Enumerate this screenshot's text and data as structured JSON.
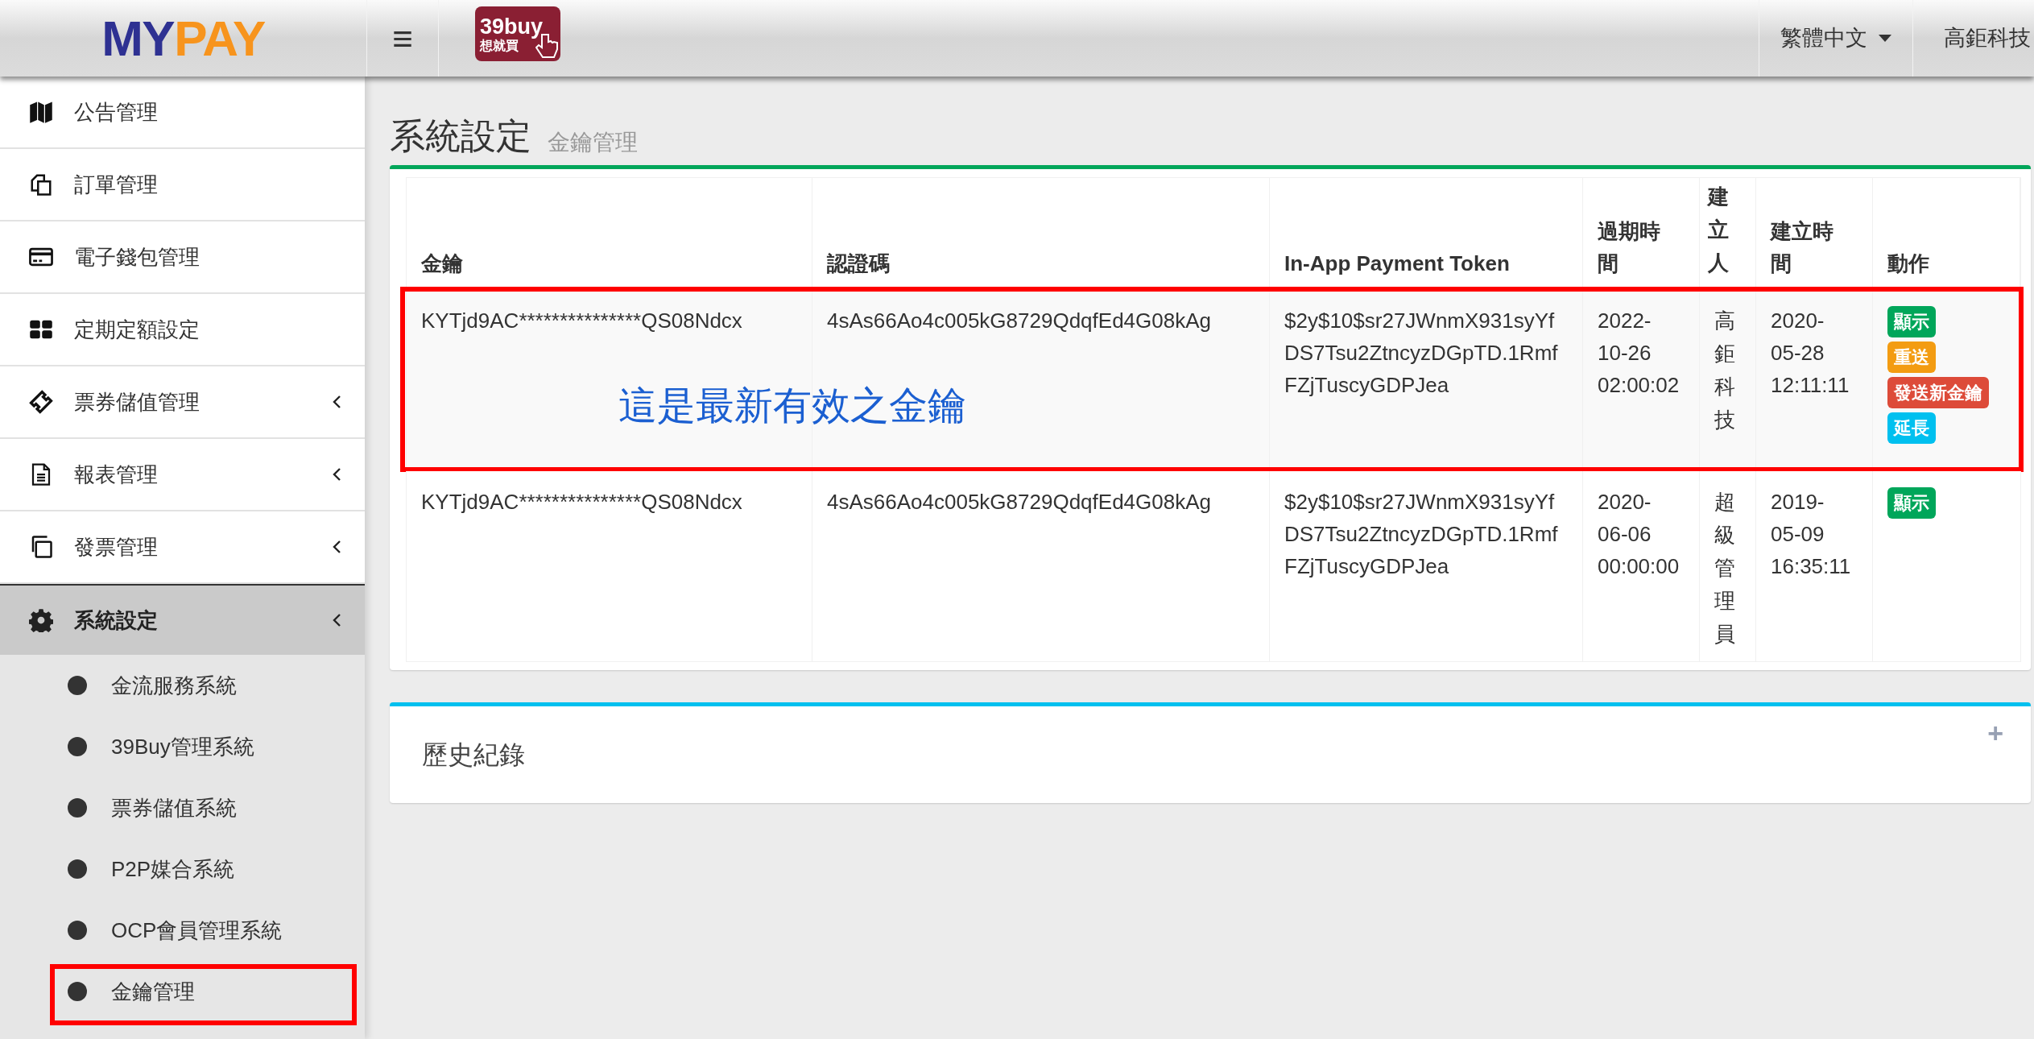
{
  "header": {
    "logo": [
      "MY",
      "PAY"
    ],
    "brand_logo": [
      "39buy",
      "想就買"
    ],
    "menu_glyph": "≡",
    "language": "繁體中文",
    "user": "高鉅科技"
  },
  "sidebar": {
    "items": [
      {
        "label": "公告管理",
        "has_submenu": false,
        "expanded": false
      },
      {
        "label": "訂單管理",
        "has_submenu": false,
        "expanded": false
      },
      {
        "label": "電子錢包管理",
        "has_submenu": false,
        "expanded": false
      },
      {
        "label": "定期定額設定",
        "has_submenu": false,
        "expanded": false
      },
      {
        "label": "票券儲值管理",
        "has_submenu": true,
        "expanded": false
      },
      {
        "label": "報表管理",
        "has_submenu": true,
        "expanded": false
      },
      {
        "label": "發票管理",
        "has_submenu": true,
        "expanded": false
      },
      {
        "label": "系統設定",
        "has_submenu": true,
        "expanded": true,
        "children": [
          {
            "label": "金流服務系統",
            "annotated": false
          },
          {
            "label": "39Buy管理系統",
            "annotated": false
          },
          {
            "label": "票券儲值系統",
            "annotated": false
          },
          {
            "label": "P2P媒合系統",
            "annotated": false
          },
          {
            "label": "OCP會員管理系統",
            "annotated": false
          },
          {
            "label": "金鑰管理",
            "annotated": true
          }
        ]
      }
    ]
  },
  "page": {
    "title": "系統設定",
    "subtitle": "金鑰管理"
  },
  "keys_table": {
    "columns": [
      "金鑰",
      "認證碼",
      "In-App Payment Token",
      "過期時間",
      "建立人",
      "建立時間",
      "動作"
    ],
    "rows": [
      {
        "cells": [
          "KYTjd9AC***************QS08Ndcx",
          "4sAs66Ao4c005kG8729QdqfEd4G08kAg",
          "$2y$10$sr27JWnmX931syYfDS7Tsu2ZtncyzDGpTD.1RmfFZjTuscyGDPJea",
          "2022-10-26 02:00:02",
          "高鉅科技",
          "2020-05-28 12:11:11"
        ],
        "actions": [
          {
            "label": "顯示",
            "color": "#00a65a"
          },
          {
            "label": "重送",
            "color": "#f39c12"
          },
          {
            "label": "發送新金鑰",
            "color": "#dd4b39"
          },
          {
            "label": "延長",
            "color": "#00c0ef"
          }
        ],
        "annotated": true,
        "note": "這是最新有效之金鑰"
      },
      {
        "cells": [
          "KYTjd9AC***************QS08Ndcx",
          "4sAs66Ao4c005kG8729QdqfEd4G08kAg",
          "$2y$10$sr27JWnmX931syYfDS7Tsu2ZtncyzDGpTD.1RmfFZjTuscyGDPJea",
          "2020-06-06 00:00:00",
          "超級管理員",
          "2019-05-09 16:35:11"
        ],
        "actions": [
          {
            "label": "顯示",
            "color": "#00a65a"
          }
        ],
        "annotated": false
      }
    ]
  },
  "history": {
    "title": "歷史紀錄",
    "toggle": "+"
  }
}
